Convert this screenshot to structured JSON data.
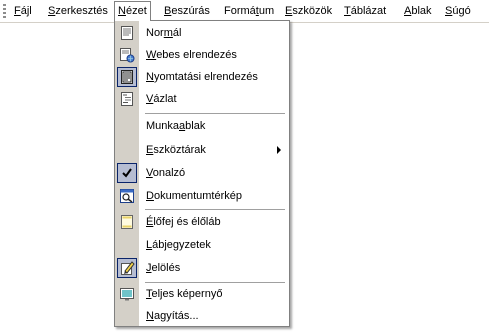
{
  "menubar": {
    "items": [
      {
        "pre": "",
        "acc": "F",
        "post": "ájl"
      },
      {
        "pre": "",
        "acc": "S",
        "post": "zerkesztés"
      },
      {
        "pre": "",
        "acc": "N",
        "post": "ézet"
      },
      {
        "pre": "",
        "acc": "B",
        "post": "eszúrás"
      },
      {
        "pre": "Formá",
        "acc": "t",
        "post": "um"
      },
      {
        "pre": "",
        "acc": "E",
        "post": "szközök"
      },
      {
        "pre": "",
        "acc": "T",
        "post": "áblázat"
      },
      {
        "pre": "",
        "acc": "A",
        "post": "blak"
      },
      {
        "pre": "",
        "acc": "S",
        "post": "úgó"
      }
    ]
  },
  "view_menu": {
    "items": [
      {
        "pre": "Nor",
        "acc": "m",
        "post": "ál",
        "icon": "normal-view-icon"
      },
      {
        "pre": "",
        "acc": "W",
        "post": "ebes elrendezés",
        "icon": "web-layout-icon"
      },
      {
        "pre": "",
        "acc": "N",
        "post": "yomtatási elrendezés",
        "icon": "print-layout-icon",
        "checked": true
      },
      {
        "pre": "",
        "acc": "V",
        "post": "ázlat",
        "icon": "outline-view-icon"
      },
      {
        "pre": "Munka",
        "acc": "a",
        "post": "blak",
        "icon": ""
      },
      {
        "pre": "",
        "acc": "E",
        "post": "szköztárak",
        "icon": "",
        "submenu": true
      },
      {
        "pre": "",
        "acc": "V",
        "post": "onalzó",
        "icon": "checkmark-icon",
        "checked": true
      },
      {
        "pre": "",
        "acc": "D",
        "post": "okumentumtérkép",
        "icon": "document-map-icon"
      },
      {
        "pre": "",
        "acc": "É",
        "post": "lőfej és élőláb",
        "icon": "header-footer-icon"
      },
      {
        "pre": "",
        "acc": "L",
        "post": "ábjegyzetek",
        "icon": ""
      },
      {
        "pre": "",
        "acc": "J",
        "post": "elölés",
        "icon": "markup-icon",
        "checked": true
      },
      {
        "pre": "",
        "acc": "T",
        "post": "eljes képernyő",
        "icon": "full-screen-icon"
      },
      {
        "pre": "",
        "acc": "N",
        "post": "agyítás...",
        "icon": ""
      }
    ]
  }
}
